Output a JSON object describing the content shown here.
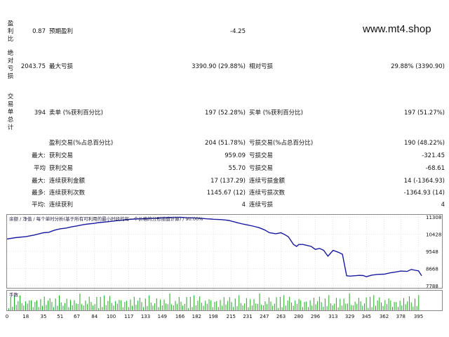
{
  "watermark": "www.mt4.shop",
  "side_labels": {
    "profit_ratio": [
      "盈",
      "利",
      "比"
    ],
    "absolute_dd": [
      "绝",
      "对",
      "亏",
      "损"
    ],
    "trade_summary": [
      "交",
      "易",
      "单",
      "总",
      "计"
    ]
  },
  "rows": {
    "r1": {
      "a_val": "0.87",
      "b_label": "预期盈利",
      "b_val": "-4.25"
    },
    "r2": {
      "a_val": "2043.75",
      "b_label": "最大亏损",
      "b_val": "3390.90 (29.88%)",
      "c_label": "相对亏损",
      "c_val": "29.88% (3390.90)"
    },
    "r3": {
      "a_val": "394",
      "b_label": "卖单 (%获利百分比)",
      "b_val": "197 (52.28%)",
      "c_label": "买单 (%获利百分比)",
      "c_val": "197 (51.27%)"
    },
    "r4": {
      "b_label": "盈利交易(%占总百分比)",
      "b_val": "204 (51.78%)",
      "c_label": "亏损交易(%占总百分比)",
      "c_val": "190 (48.22%)"
    },
    "r5": {
      "a_lbl": "最大:",
      "b_label": "获利交易",
      "b_val": "959.09",
      "c_label": "亏损交易",
      "c_val": "-321.45"
    },
    "r6": {
      "a_lbl": "平均",
      "b_label": "获利交易",
      "b_val": "55.70",
      "c_label": "亏损交易",
      "c_val": "-68.61"
    },
    "r7": {
      "a_lbl": "最大:",
      "b_label": "连续获利金额",
      "b_val": "17 (137.29)",
      "c_label": "连续亏损金额",
      "c_val": "14 (-1364.93)"
    },
    "r8": {
      "a_lbl": "最多:",
      "b_label": "连续获利次数",
      "b_val": "1145.67 (12)",
      "c_label": "连续亏损次数",
      "c_val": "-1364.93 (14)"
    },
    "r9": {
      "a_lbl": "平均:",
      "b_label": "连续获利",
      "b_val": "4",
      "c_label": "连续亏损",
      "c_val": "4"
    }
  },
  "chart_data": {
    "type": "line",
    "legend_text": "余额 / 净值 / 每个单时分析(基于所有可利用的最小时段的每一个价格的分形插值计算) / 90.00%",
    "legend_items": [
      "余额",
      "净值"
    ],
    "volume_label": "手数",
    "y_ticks": [
      "11308",
      "10428",
      "9548",
      "8668",
      "7788"
    ],
    "ylim": [
      7788,
      11308
    ],
    "x_ticks": [
      "0",
      "18",
      "35",
      "51",
      "67",
      "84",
      "100",
      "117",
      "133",
      "149",
      "166",
      "182",
      "198",
      "215",
      "231",
      "247",
      "263",
      "280",
      "296",
      "313",
      "329",
      "345",
      "362",
      "378",
      "395"
    ],
    "xlim": [
      0,
      398
    ],
    "colors": {
      "balance": "#1a1aa0",
      "volume": "#22aa22",
      "grid": "#c8c8c8"
    },
    "balance": {
      "x": [
        0,
        8,
        18,
        26,
        35,
        40,
        44,
        47,
        51,
        57,
        62,
        67,
        70,
        74,
        78,
        84,
        88,
        92,
        96,
        100,
        106,
        110,
        114,
        117,
        122,
        128,
        133,
        138,
        142,
        146,
        149,
        152,
        156,
        160,
        166,
        172,
        178,
        182,
        188,
        192,
        196,
        198,
        202,
        206,
        210,
        213,
        215,
        218,
        222,
        226,
        231,
        236,
        242,
        247,
        252,
        258,
        263,
        266,
        270,
        275,
        278,
        280,
        284,
        288,
        292,
        296,
        300,
        304,
        308,
        313,
        318,
        322,
        326,
        329,
        334,
        338,
        342,
        345,
        350,
        356,
        362,
        368,
        374,
        378,
        384,
        388,
        392,
        395,
        398
      ],
      "y": [
        10180,
        10250,
        10300,
        10380,
        10500,
        10520,
        10600,
        10650,
        10700,
        10740,
        10800,
        10850,
        10880,
        10920,
        10950,
        10980,
        11020,
        11040,
        11060,
        11080,
        11120,
        11140,
        11160,
        11180,
        11200,
        11210,
        11220,
        11230,
        11240,
        11250,
        11260,
        11270,
        11280,
        11285,
        11290,
        11270,
        11260,
        11250,
        11230,
        11210,
        11200,
        11190,
        11180,
        11170,
        11150,
        11130,
        11100,
        11060,
        11000,
        10950,
        10900,
        10840,
        10760,
        10650,
        10500,
        10450,
        10500,
        10420,
        10300,
        9900,
        9800,
        9900,
        9900,
        9850,
        9800,
        9650,
        9700,
        9600,
        9300,
        9600,
        9500,
        9400,
        8300,
        8280,
        8300,
        8320,
        8310,
        8250,
        8330,
        8370,
        8380,
        8450,
        8500,
        8540,
        8520,
        8620,
        8580,
        8550,
        8300
      ]
    },
    "volume_profile": [
      0.2,
      0.8,
      0.3,
      0.9,
      0.4,
      0.6,
      1.0,
      0.5,
      0.3,
      0.7,
      0.4,
      0.9,
      0.6,
      0.3,
      0.5,
      0.8
    ]
  }
}
